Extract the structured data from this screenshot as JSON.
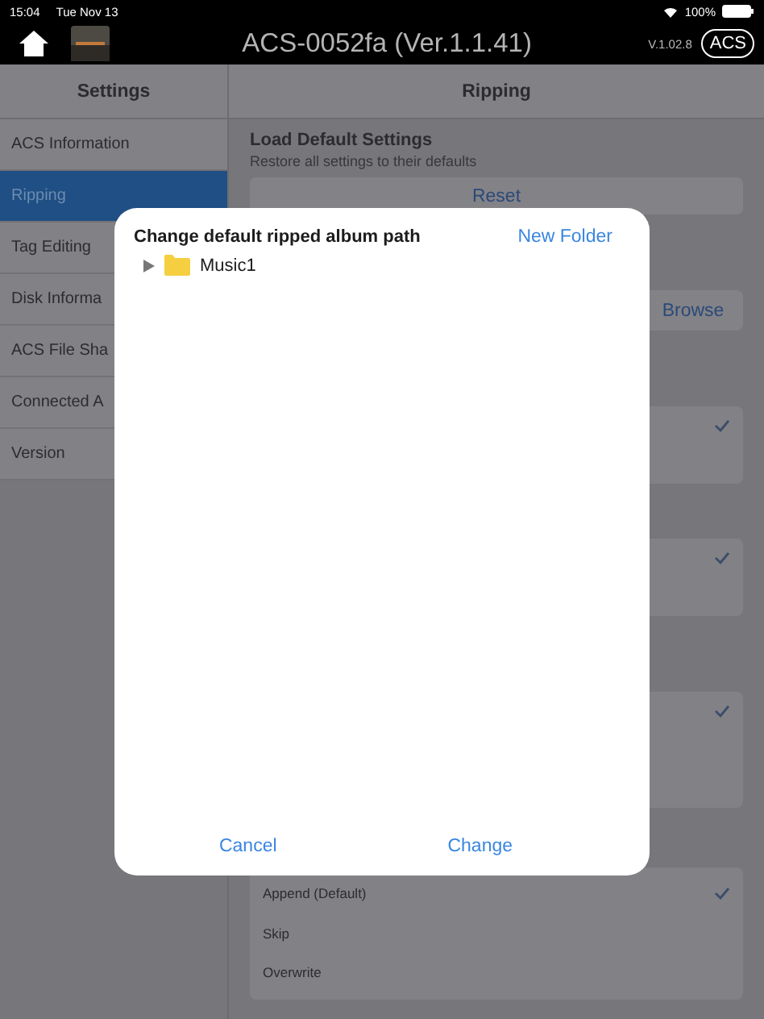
{
  "status_bar": {
    "time": "15:04",
    "date": "Tue Nov 13",
    "battery": "100%"
  },
  "nav": {
    "title": "ACS-0052fa (Ver.1.1.41)",
    "version": "V.1.02.8",
    "badge": "ACS"
  },
  "sidebar": {
    "title": "Settings",
    "items": [
      {
        "label": "ACS Information",
        "selected": false
      },
      {
        "label": "Ripping",
        "selected": true
      },
      {
        "label": "Tag Editing",
        "selected": false
      },
      {
        "label": "Disk Informa",
        "selected": false
      },
      {
        "label": "ACS File Sha",
        "selected": false
      },
      {
        "label": "Connected A",
        "selected": false
      },
      {
        "label": "Version",
        "selected": false
      }
    ]
  },
  "content": {
    "title": "Ripping",
    "load_default": {
      "title": "Load Default Settings",
      "subtitle": "Restore all settings to their defaults",
      "button": "Reset"
    },
    "browse_button": "Browse",
    "option_groups": [
      {
        "checked": true
      },
      {
        "checked": true
      },
      {
        "checked": true
      }
    ],
    "options": [
      {
        "label": "Append (Default)",
        "checked": true
      },
      {
        "label": "Skip",
        "checked": false
      },
      {
        "label": "Overwrite",
        "checked": false
      }
    ]
  },
  "dialog": {
    "title": "Change default ripped album path",
    "new_folder": "New Folder",
    "tree": [
      {
        "label": "Music1",
        "expanded": false
      }
    ],
    "cancel": "Cancel",
    "change": "Change"
  }
}
